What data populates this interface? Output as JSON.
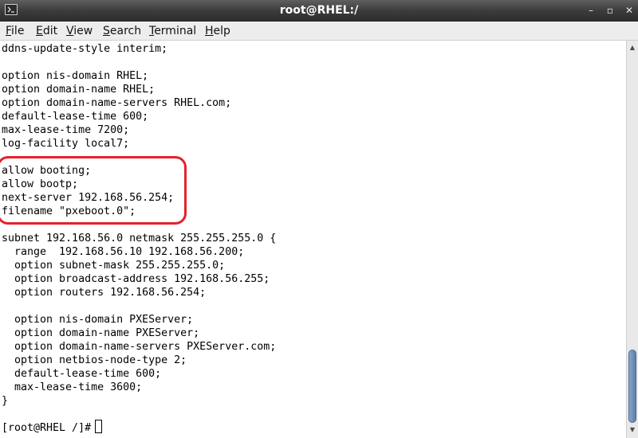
{
  "window": {
    "title": "root@RHEL:/",
    "controls": {
      "minimize": "–",
      "maximize": "▫",
      "close": "✕"
    }
  },
  "menu": [
    {
      "mnemonic": "F",
      "rest": "ile"
    },
    {
      "mnemonic": "E",
      "rest": "dit"
    },
    {
      "mnemonic": "V",
      "rest": "iew"
    },
    {
      "mnemonic": "S",
      "rest": "earch"
    },
    {
      "mnemonic": "T",
      "rest": "erminal"
    },
    {
      "mnemonic": "H",
      "rest": "elp"
    }
  ],
  "terminal": {
    "lines": [
      "ddns-update-style interim;",
      "",
      "option nis-domain RHEL;",
      "option domain-name RHEL;",
      "option domain-name-servers RHEL.com;",
      "default-lease-time 600;",
      "max-lease-time 7200;",
      "log-facility local7;",
      "",
      "allow booting;",
      "allow bootp;",
      "next-server 192.168.56.254;",
      "filename \"pxeboot.0\";",
      "",
      "subnet 192.168.56.0 netmask 255.255.255.0 {",
      "  range  192.168.56.10 192.168.56.200;",
      "  option subnet-mask 255.255.255.0;",
      "  option broadcast-address 192.168.56.255;",
      "  option routers 192.168.56.254;",
      "",
      "  option nis-domain PXEServer;",
      "  option domain-name PXEServer;",
      "  option domain-name-servers PXEServer.com;",
      "  option netbios-node-type 2;",
      "  default-lease-time 600;",
      "  max-lease-time 3600;",
      "}",
      "",
      "[root@RHEL /]# "
    ],
    "highlight_color": "#e3222b"
  },
  "scrollbar": {
    "up_arrow": "▲",
    "down_arrow": "▼",
    "position_fraction": 0.82
  },
  "icons": {
    "window_icon": "terminal-icon"
  }
}
